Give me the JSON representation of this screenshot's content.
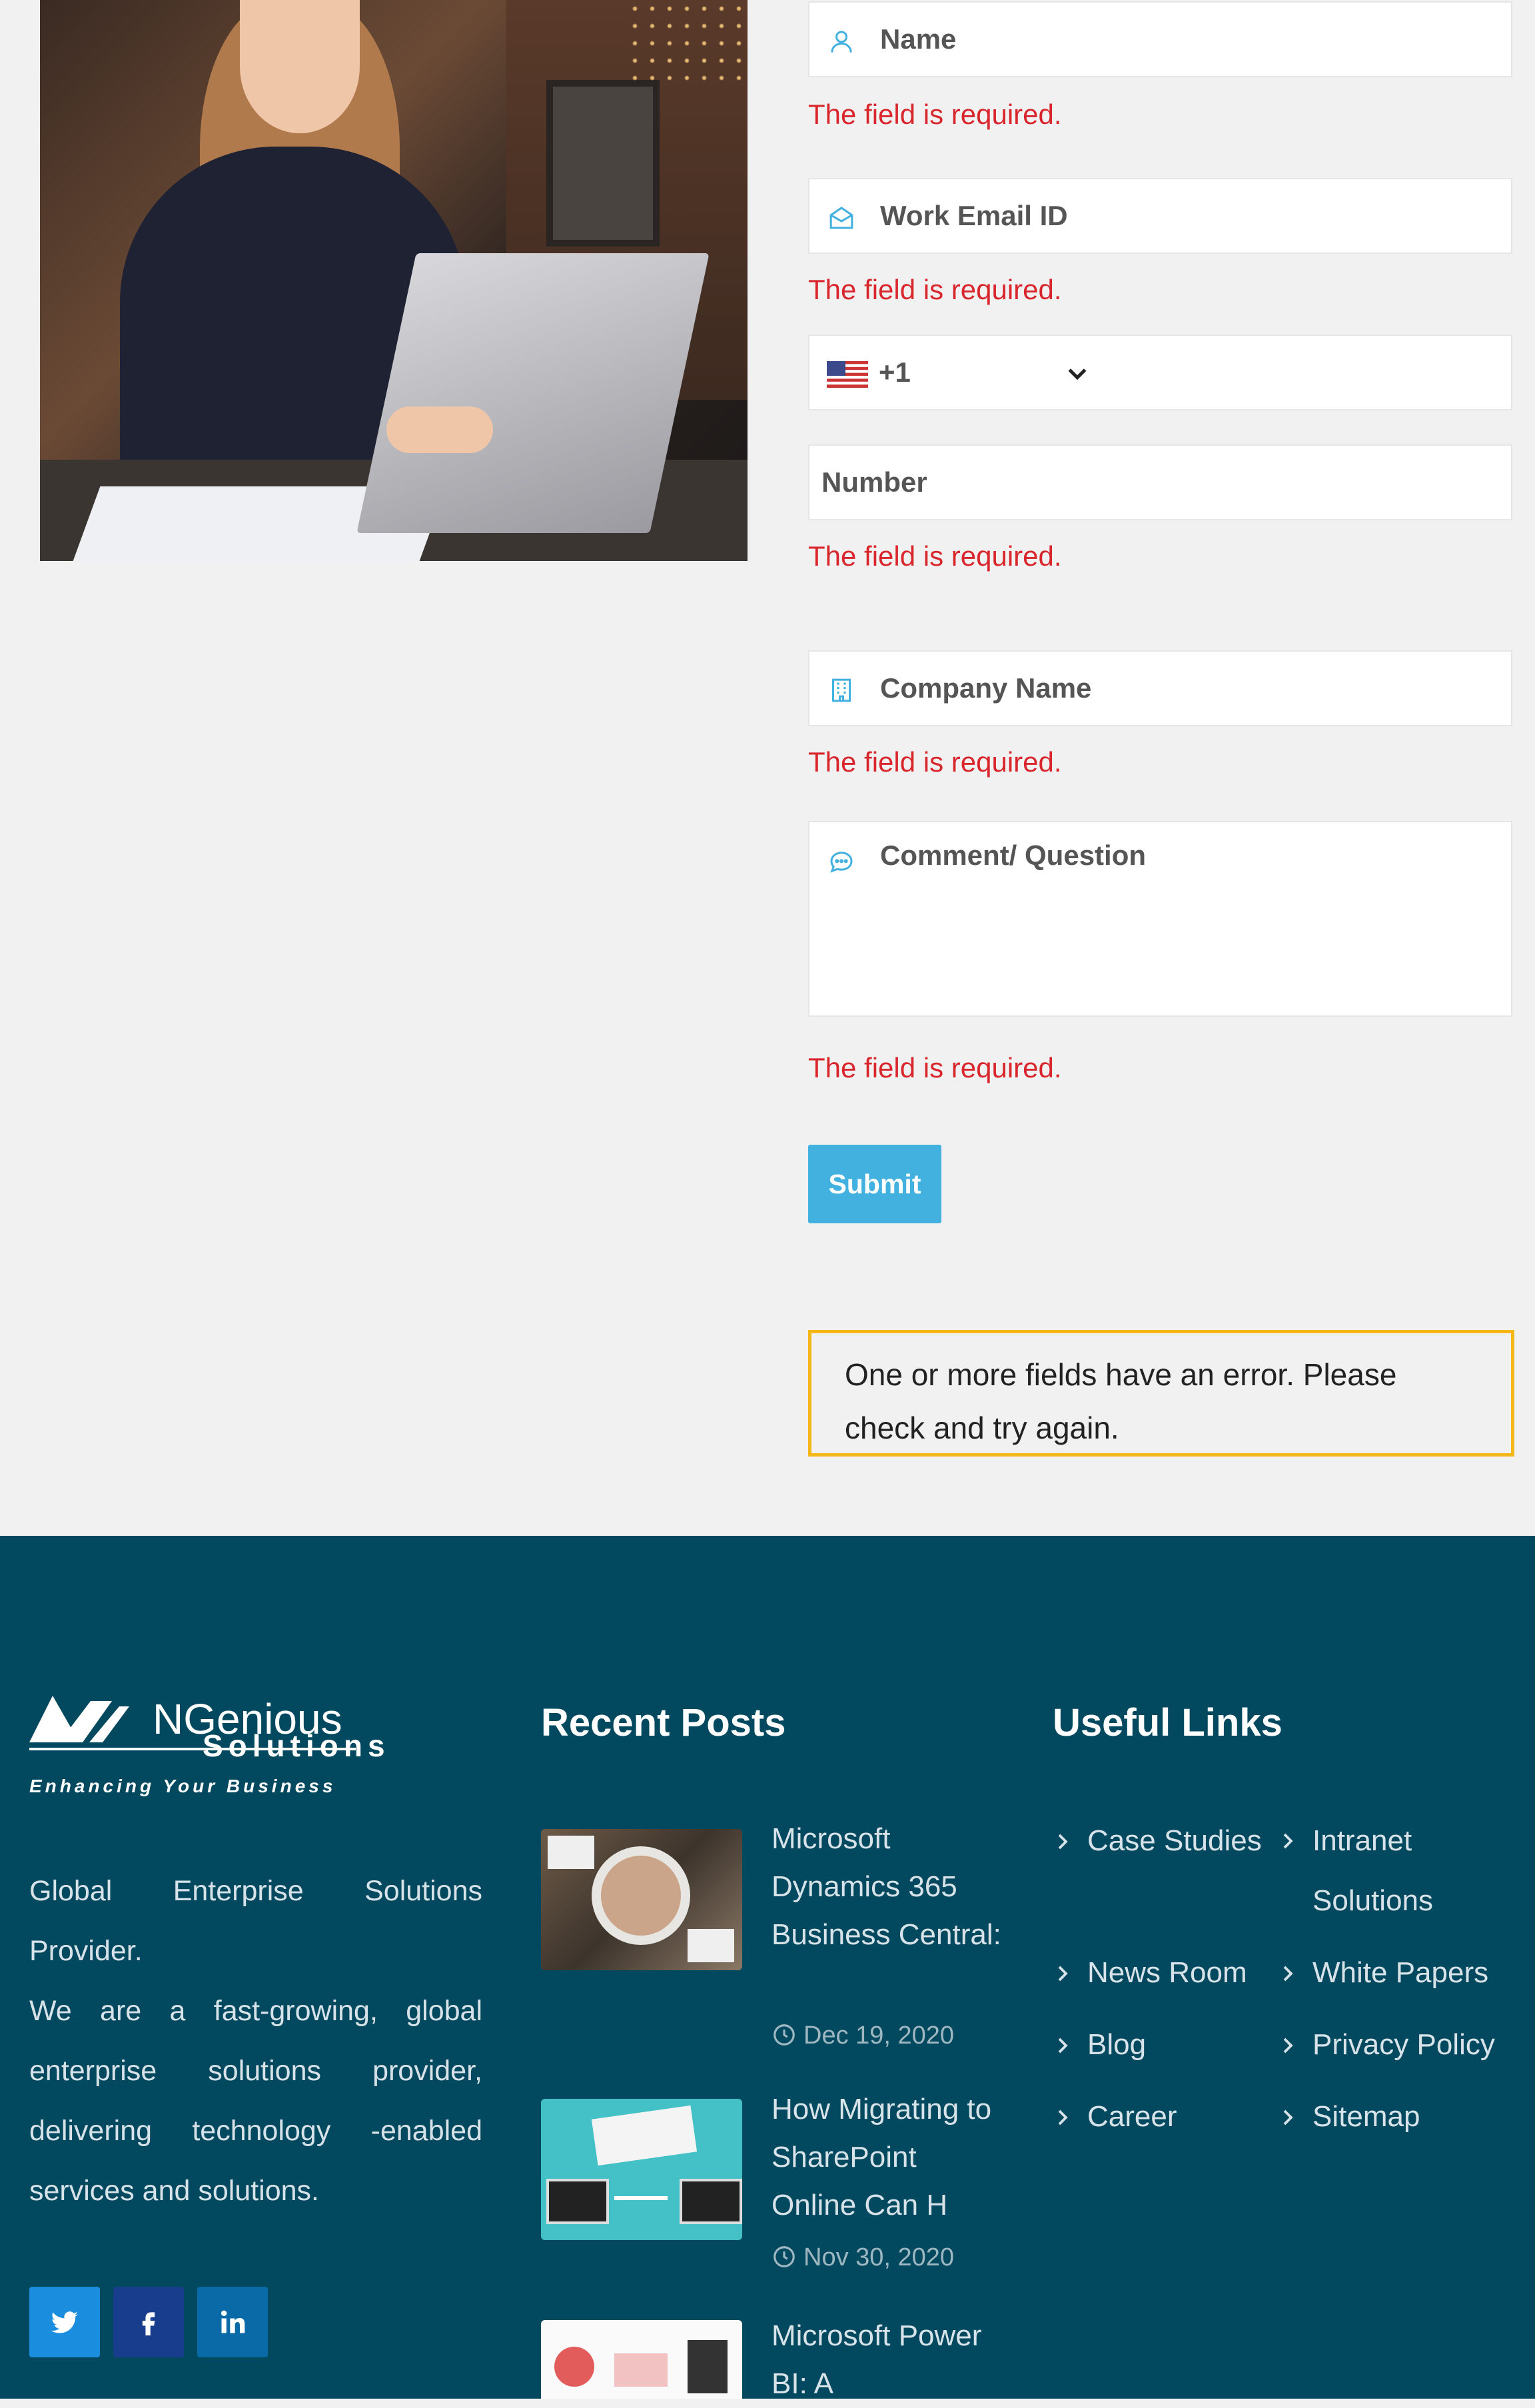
{
  "form": {
    "name_placeholder": "Name",
    "email_placeholder": "Work Email ID",
    "phone_code": "+1",
    "phone_country": "US flag",
    "number_placeholder": "Number",
    "company_placeholder": "Company Name",
    "comment_placeholder": "Comment/ Question",
    "required_error": "The field is required.",
    "submit_label": "Submit",
    "validation_message": "One or more fields have an error. Please check and try again."
  },
  "footer": {
    "logo_text": "NGenious",
    "logo_sub": "Solutions",
    "logo_tagline": "Enhancing Your Business",
    "about_line1": "Global Enterprise Solutions Provider.",
    "about_line2": "We are a fast-growing, global enterprise solutions provider, delivering technology -enabled services and solutions.",
    "recent_posts_title": "Recent Posts",
    "useful_links_title": "Useful Links",
    "posts": [
      {
        "title": "Microsoft Dynamics 365 Business Central:",
        "date": "Dec 19, 2020"
      },
      {
        "title": "How Migrating to SharePoint Online Can H",
        "date": "Nov 30, 2020"
      },
      {
        "title": "Microsoft Power BI: A",
        "date": ""
      }
    ],
    "links_col1": [
      "Case Studies",
      "News Room",
      "Blog",
      "Career"
    ],
    "links_col2": [
      "Intranet Solutions",
      "White Papers",
      "Privacy Policy",
      "Sitemap"
    ],
    "social": [
      "twitter-icon",
      "facebook-icon",
      "linkedin-icon"
    ]
  },
  "colors": {
    "accent": "#42b1e0",
    "error": "#d8262c",
    "footer_bg": "#02495f",
    "alert_border": "#f6b819"
  }
}
